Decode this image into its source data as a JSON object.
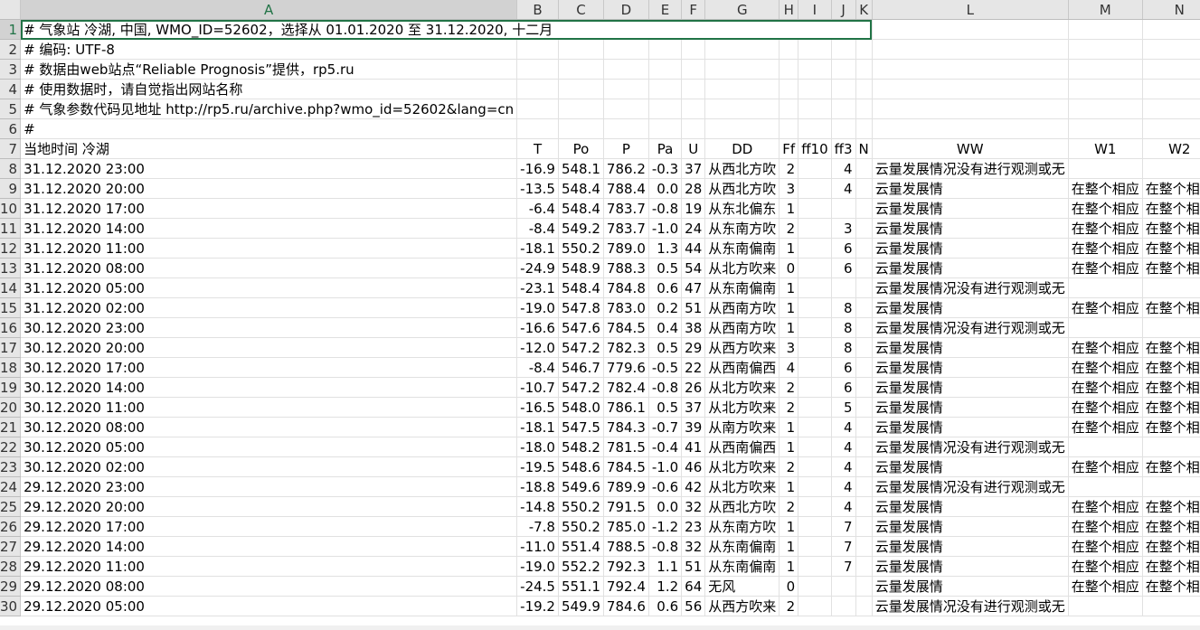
{
  "columns": [
    "A",
    "B",
    "C",
    "D",
    "E",
    "F",
    "G",
    "H",
    "I",
    "J",
    "K",
    "L",
    "M",
    "N"
  ],
  "header_rows": [
    {
      "num": "1",
      "a": "# 气象站 冷湖, 中国, WMO_ID=52602，选择从 01.01.2020 至 31.12.2020, 十二月"
    },
    {
      "num": "2",
      "a": "# 编码: UTF-8"
    },
    {
      "num": "3",
      "a": "# 数据由web站点“Reliable Prognosis”提供，rp5.ru"
    },
    {
      "num": "4",
      "a": "# 使用数据时，请自觉指出网站名称"
    },
    {
      "num": "5",
      "a": "# 气象参数代码见地址 http://rp5.ru/archive.php?wmo_id=52602&lang=cn"
    },
    {
      "num": "6",
      "a": "#"
    }
  ],
  "field_row": {
    "num": "7",
    "cells": [
      "当地时间 冷湖",
      "T",
      "Po",
      "P",
      "Pa",
      "U",
      "DD",
      "Ff",
      "ff10",
      "ff3",
      "N",
      "WW",
      "W1",
      "W2"
    ]
  },
  "data_rows": [
    {
      "num": "8",
      "cells": [
        "31.12.2020 23:00",
        "-16.9",
        "548.1",
        "786.2",
        "-0.3",
        "37",
        "从西北方吹",
        "2",
        "",
        "4",
        "",
        "云量发展情况没有进行观测或无",
        "",
        ""
      ]
    },
    {
      "num": "9",
      "cells": [
        "31.12.2020 20:00",
        "-13.5",
        "548.4",
        "788.4",
        "0.0",
        "28",
        "从西北方吹",
        "3",
        "",
        "4",
        "",
        "云量发展情",
        "在整个相应",
        "在整个相应"
      ]
    },
    {
      "num": "10",
      "cells": [
        "31.12.2020 17:00",
        "-6.4",
        "548.4",
        "783.7",
        "-0.8",
        "19",
        "从东北偏东",
        "1",
        "",
        "",
        "",
        "云量发展情",
        "在整个相应",
        "在整个相应"
      ]
    },
    {
      "num": "11",
      "cells": [
        "31.12.2020 14:00",
        "-8.4",
        "549.2",
        "783.7",
        "-1.0",
        "24",
        "从东南方吹",
        "2",
        "",
        "3",
        "",
        "云量发展情",
        "在整个相应",
        "在整个相应"
      ]
    },
    {
      "num": "12",
      "cells": [
        "31.12.2020 11:00",
        "-18.1",
        "550.2",
        "789.0",
        "1.3",
        "44",
        "从东南偏南",
        "1",
        "",
        "6",
        "",
        "云量发展情",
        "在整个相应",
        "在整个相应"
      ]
    },
    {
      "num": "13",
      "cells": [
        "31.12.2020 08:00",
        "-24.9",
        "548.9",
        "788.3",
        "0.5",
        "54",
        "从北方吹来",
        "0",
        "",
        "6",
        "",
        "云量发展情",
        "在整个相应",
        "在整个相应"
      ]
    },
    {
      "num": "14",
      "cells": [
        "31.12.2020 05:00",
        "-23.1",
        "548.4",
        "784.8",
        "0.6",
        "47",
        "从东南偏南",
        "1",
        "",
        "",
        "",
        "云量发展情况没有进行观测或无",
        "",
        ""
      ]
    },
    {
      "num": "15",
      "cells": [
        "31.12.2020 02:00",
        "-19.0",
        "547.8",
        "783.0",
        "0.2",
        "51",
        "从西南方吹",
        "1",
        "",
        "8",
        "",
        "云量发展情",
        "在整个相应",
        "在整个相应"
      ]
    },
    {
      "num": "16",
      "cells": [
        "30.12.2020 23:00",
        "-16.6",
        "547.6",
        "784.5",
        "0.4",
        "38",
        "从西南方吹",
        "1",
        "",
        "8",
        "",
        "云量发展情况没有进行观测或无",
        "",
        ""
      ]
    },
    {
      "num": "17",
      "cells": [
        "30.12.2020 20:00",
        "-12.0",
        "547.2",
        "782.3",
        "0.5",
        "29",
        "从西方吹来",
        "3",
        "",
        "8",
        "",
        "云量发展情",
        "在整个相应",
        "在整个相应"
      ]
    },
    {
      "num": "18",
      "cells": [
        "30.12.2020 17:00",
        "-8.4",
        "546.7",
        "779.6",
        "-0.5",
        "22",
        "从西南偏西",
        "4",
        "",
        "6",
        "",
        "云量发展情",
        "在整个相应",
        "在整个相应"
      ]
    },
    {
      "num": "19",
      "cells": [
        "30.12.2020 14:00",
        "-10.7",
        "547.2",
        "782.4",
        "-0.8",
        "26",
        "从北方吹来",
        "2",
        "",
        "6",
        "",
        "云量发展情",
        "在整个相应",
        "在整个相应"
      ]
    },
    {
      "num": "20",
      "cells": [
        "30.12.2020 11:00",
        "-16.5",
        "548.0",
        "786.1",
        "0.5",
        "37",
        "从北方吹来",
        "2",
        "",
        "5",
        "",
        "云量发展情",
        "在整个相应",
        "在整个相应"
      ]
    },
    {
      "num": "21",
      "cells": [
        "30.12.2020 08:00",
        "-18.1",
        "547.5",
        "784.3",
        "-0.7",
        "39",
        "从南方吹来",
        "1",
        "",
        "4",
        "",
        "云量发展情",
        "在整个相应",
        "在整个相应"
      ]
    },
    {
      "num": "22",
      "cells": [
        "30.12.2020 05:00",
        "-18.0",
        "548.2",
        "781.5",
        "-0.4",
        "41",
        "从西南偏西",
        "1",
        "",
        "4",
        "",
        "云量发展情况没有进行观测或无",
        "",
        ""
      ]
    },
    {
      "num": "23",
      "cells": [
        "30.12.2020 02:00",
        "-19.5",
        "548.6",
        "784.5",
        "-1.0",
        "46",
        "从北方吹来",
        "2",
        "",
        "4",
        "",
        "云量发展情",
        "在整个相应",
        "在整个相应"
      ]
    },
    {
      "num": "24",
      "cells": [
        "29.12.2020 23:00",
        "-18.8",
        "549.6",
        "789.9",
        "-0.6",
        "42",
        "从北方吹来",
        "1",
        "",
        "4",
        "",
        "云量发展情况没有进行观测或无",
        "",
        ""
      ]
    },
    {
      "num": "25",
      "cells": [
        "29.12.2020 20:00",
        "-14.8",
        "550.2",
        "791.5",
        "0.0",
        "32",
        "从西北方吹",
        "2",
        "",
        "4",
        "",
        "云量发展情",
        "在整个相应",
        "在整个相应"
      ]
    },
    {
      "num": "26",
      "cells": [
        "29.12.2020 17:00",
        "-7.8",
        "550.2",
        "785.0",
        "-1.2",
        "23",
        "从东南方吹",
        "1",
        "",
        "7",
        "",
        "云量发展情",
        "在整个相应",
        "在整个相应"
      ]
    },
    {
      "num": "27",
      "cells": [
        "29.12.2020 14:00",
        "-11.0",
        "551.4",
        "788.5",
        "-0.8",
        "32",
        "从东南偏南",
        "1",
        "",
        "7",
        "",
        "云量发展情",
        "在整个相应",
        "在整个相应"
      ]
    },
    {
      "num": "28",
      "cells": [
        "29.12.2020 11:00",
        "-19.0",
        "552.2",
        "792.3",
        "1.1",
        "51",
        "从东南偏南",
        "1",
        "",
        "7",
        "",
        "云量发展情",
        "在整个相应",
        "在整个相应"
      ]
    },
    {
      "num": "29",
      "cells": [
        "29.12.2020 08:00",
        "-24.5",
        "551.1",
        "792.4",
        "1.2",
        "64",
        "无风",
        "0",
        "",
        "",
        "",
        "云量发展情",
        "在整个相应",
        "在整个相应"
      ]
    },
    {
      "num": "30",
      "cells": [
        "29.12.2020 05:00",
        "-19.2",
        "549.9",
        "784.6",
        "0.6",
        "56",
        "从西方吹来",
        "2",
        "",
        "",
        "",
        "云量发展情况没有进行观测或无",
        "",
        ""
      ]
    }
  ],
  "selected_cell": "A1",
  "colors": {
    "header_bg": "#e6e6e6",
    "selection": "#217346",
    "gridline": "#e1e1e1"
  }
}
